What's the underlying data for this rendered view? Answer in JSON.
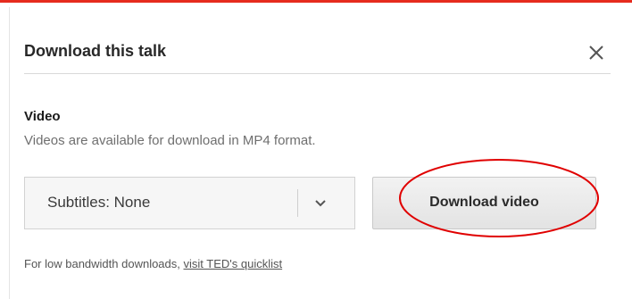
{
  "dialog": {
    "title": "Download this talk",
    "close_icon": "close-icon"
  },
  "video_section": {
    "heading": "Video",
    "description": "Videos are available for download in MP4 format."
  },
  "subtitles_select": {
    "value": "Subtitles: None",
    "icon": "chevron-down-icon"
  },
  "download_button": {
    "label": "Download video"
  },
  "footnote": {
    "text": "For low bandwidth downloads, ",
    "link_text": "visit TED's quicklist"
  },
  "colors": {
    "accent_bar": "#e62b1e",
    "annotation_ellipse": "#e00000"
  }
}
